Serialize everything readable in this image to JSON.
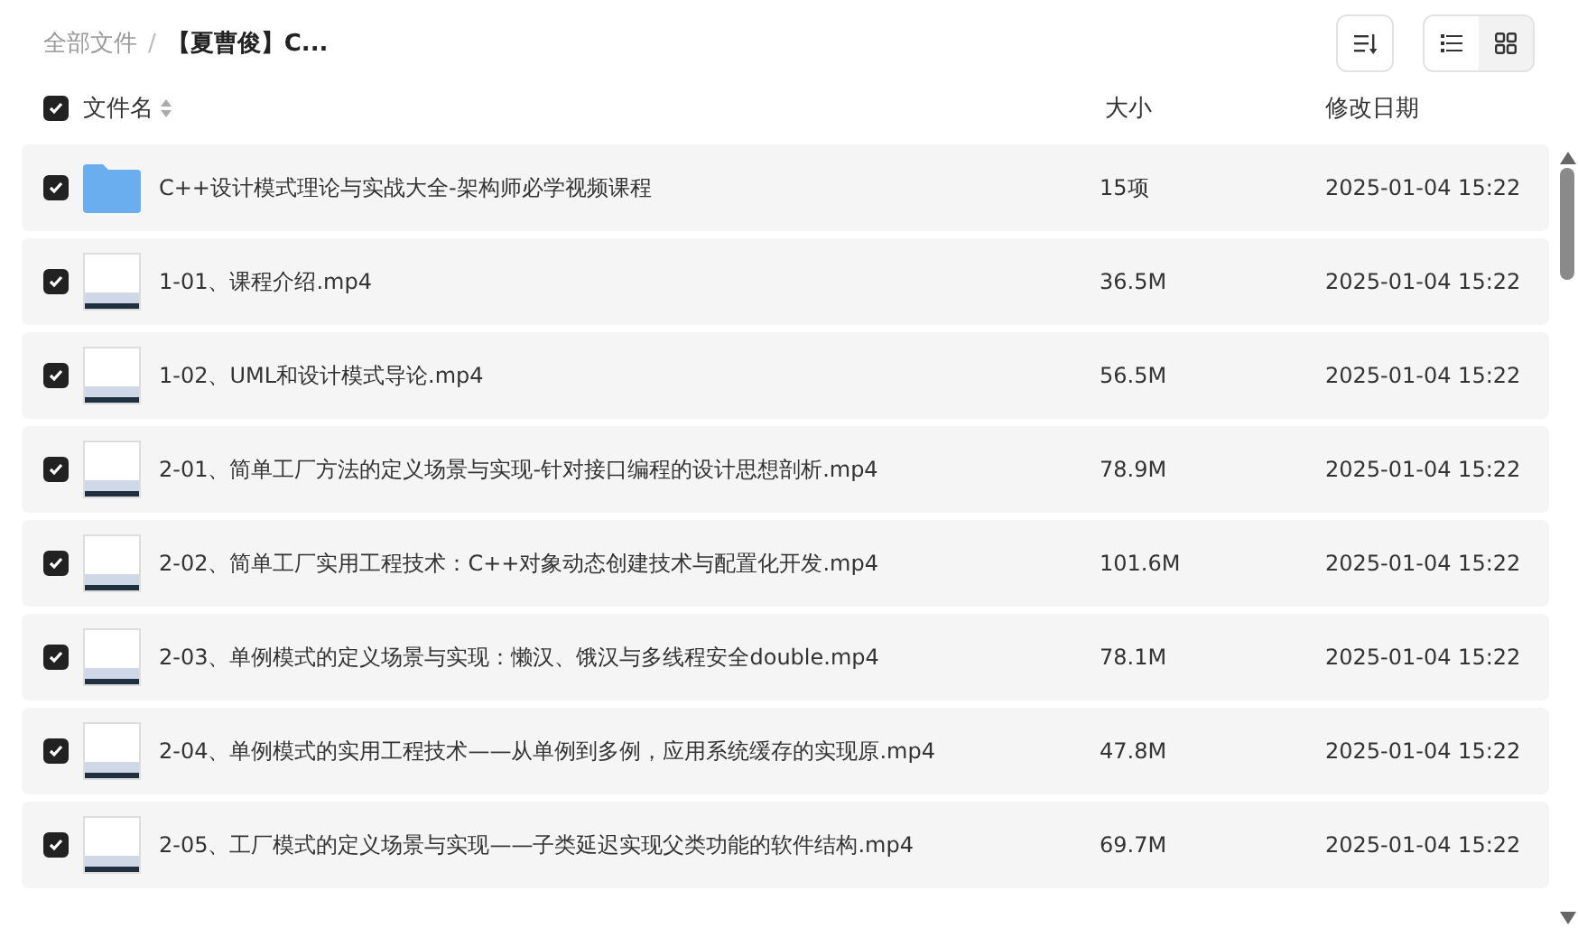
{
  "breadcrumb_separator": "/",
  "breadcrumb": [
    {
      "label": "全部文件",
      "current": false
    },
    {
      "label": "【夏曹俊】C...",
      "current": true
    }
  ],
  "views": [
    {
      "kind": "list",
      "selected": true
    },
    {
      "kind": "grid",
      "selected": false
    }
  ],
  "table": {
    "select_all_checked": true,
    "columns": [
      "文件名",
      "大小",
      "修改日期"
    ],
    "rows": [
      {
        "kind": "folder",
        "checked": true,
        "name": "C++设计模式理论与实战大全-架构师必学视频课程",
        "size": "15项",
        "date": "2025-01-04 15:22"
      },
      {
        "kind": "video",
        "checked": true,
        "name": "1-01、课程介绍.mp4",
        "size": "36.5M",
        "date": "2025-01-04 15:22"
      },
      {
        "kind": "video",
        "checked": true,
        "name": "1-02、UML和设计模式导论.mp4",
        "size": "56.5M",
        "date": "2025-01-04 15:22"
      },
      {
        "kind": "video",
        "checked": true,
        "name": "2-01、简单工厂方法的定义场景与实现-针对接口编程的设计思想剖析.mp4",
        "size": "78.9M",
        "date": "2025-01-04 15:22"
      },
      {
        "kind": "video",
        "checked": true,
        "name": "2-02、简单工厂实用工程技术：C++对象动态创建技术与配置化开发.mp4",
        "size": "101.6M",
        "date": "2025-01-04 15:22"
      },
      {
        "kind": "video",
        "checked": true,
        "name": "2-03、单例模式的定义场景与实现：懒汉、饿汉与多线程安全double.mp4",
        "size": "78.1M",
        "date": "2025-01-04 15:22"
      },
      {
        "kind": "video",
        "checked": true,
        "name": "2-04、单例模式的实用工程技术——从单例到多例，应用系统缓存的实现原.mp4",
        "size": "47.8M",
        "date": "2025-01-04 15:22"
      },
      {
        "kind": "video",
        "checked": true,
        "name": "2-05、工厂模式的定义场景与实现——子类延迟实现父类功能的软件结构.mp4",
        "size": "69.7M",
        "date": "2025-01-04 15:22"
      }
    ]
  }
}
